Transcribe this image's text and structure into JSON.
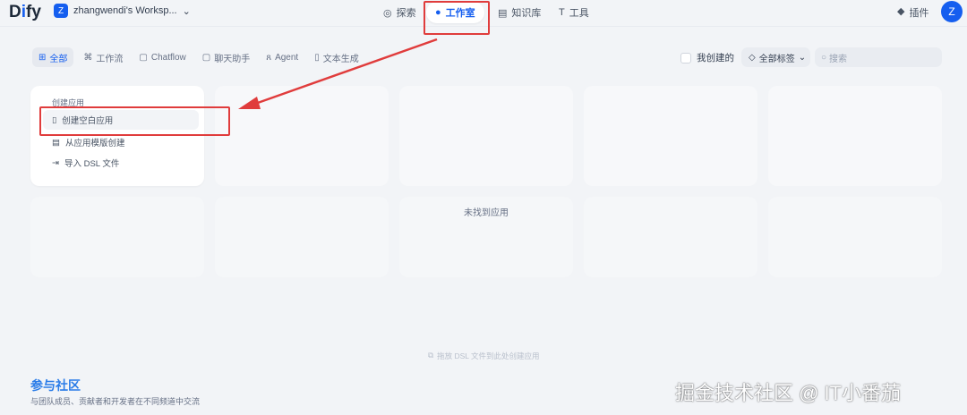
{
  "header": {
    "logo": "Dify",
    "workspace_initial": "Z",
    "workspace": "zhangwendi's Worksp...",
    "nav": [
      {
        "label": "探索"
      },
      {
        "label": "工作室"
      },
      {
        "label": "知识库"
      },
      {
        "label": "工具"
      }
    ],
    "plugins": "插件",
    "avatar": "Z"
  },
  "filters": {
    "tabs": [
      "全部",
      "工作流",
      "Chatflow",
      "聊天助手",
      "Agent",
      "文本生成"
    ],
    "my_created": "我创建的",
    "tags": "全部标签",
    "search_placeholder": "搜索"
  },
  "create": {
    "title": "创建应用",
    "items": [
      "创建空白应用",
      "从应用模版创建",
      "导入 DSL 文件"
    ]
  },
  "empty": "未找到应用",
  "drop_hint": "拖放 DSL 文件到此处创建应用",
  "community": {
    "title": "参与社区",
    "subtitle": "与团队成员、贡献者和开发者在不同频道中交流"
  },
  "watermark": "掘金技术社区 @ IT小番茄",
  "colors": {
    "accent": "#155eef",
    "annotation": "#e03c3c"
  }
}
